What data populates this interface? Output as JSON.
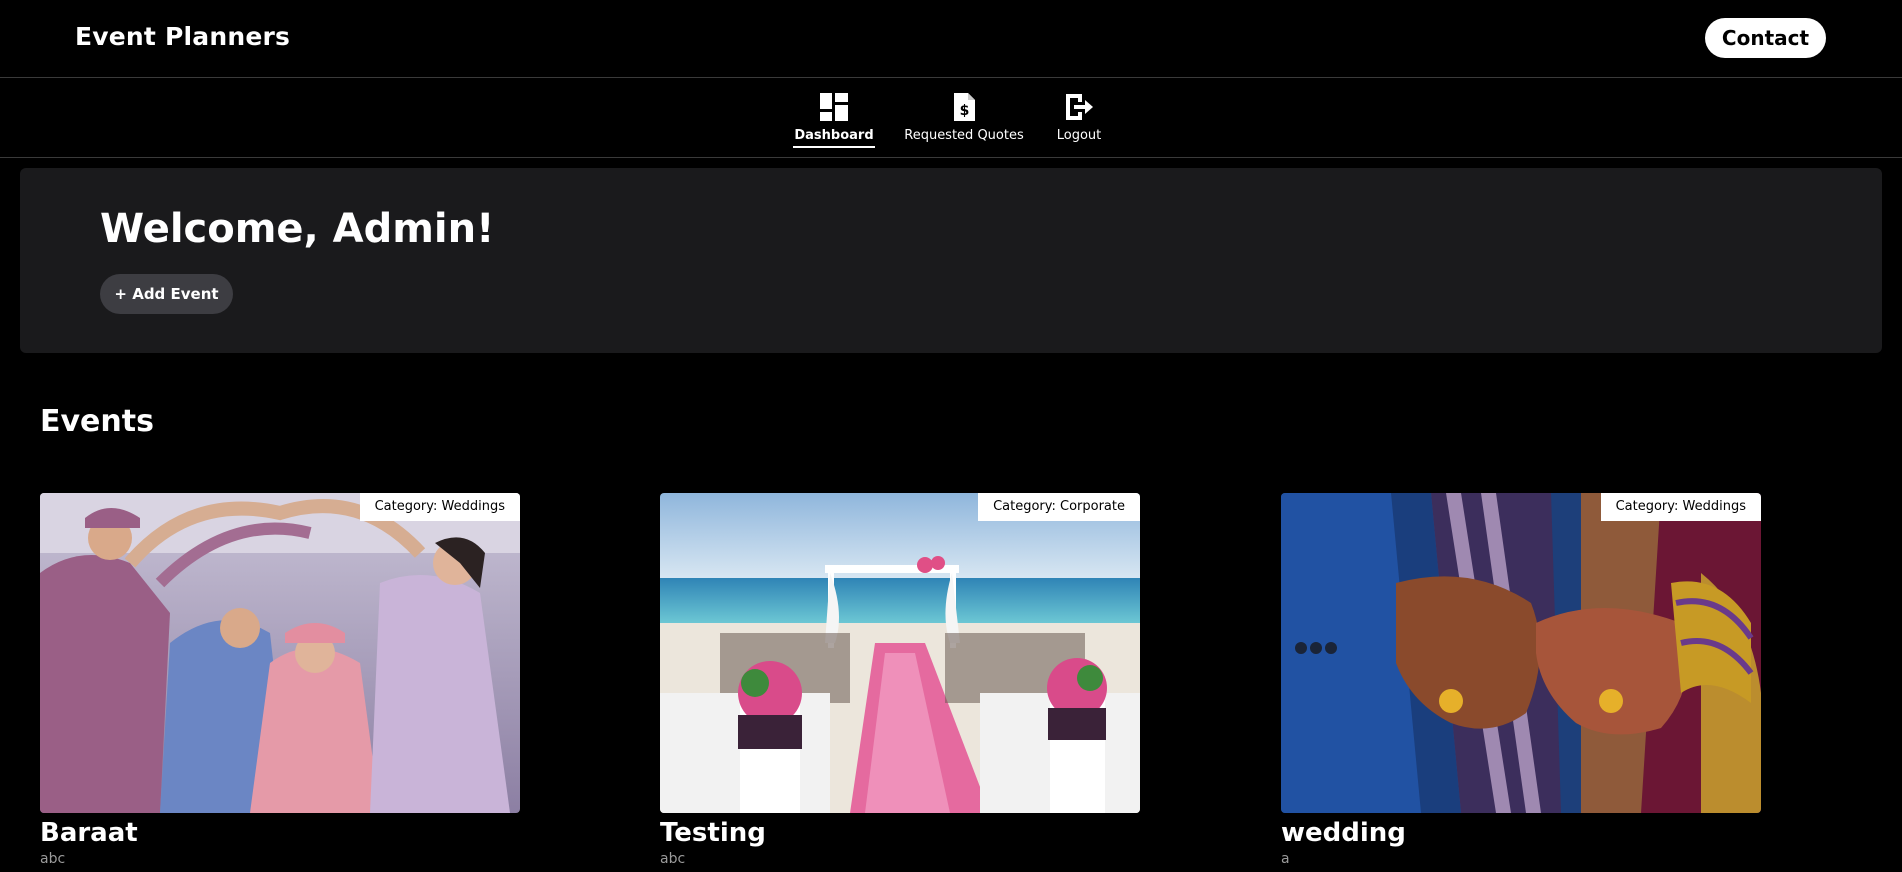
{
  "header": {
    "brand": "Event Planners",
    "contact_label": "Contact"
  },
  "nav": {
    "items": [
      {
        "label": "Dashboard",
        "icon": "dashboard-icon",
        "active": true
      },
      {
        "label": "Requested Quotes",
        "icon": "quote-document-icon",
        "active": false
      },
      {
        "label": "Logout",
        "icon": "logout-icon",
        "active": false
      }
    ]
  },
  "welcome": {
    "title": "Welcome, Admin!",
    "add_event_label": "+ Add Event"
  },
  "events": {
    "heading": "Events",
    "items": [
      {
        "title": "Baraat",
        "description": "abc",
        "category": "Category: Weddings",
        "image": "wedding-arch-photo"
      },
      {
        "title": "Testing",
        "description": "abc",
        "category": "Category: Corporate",
        "image": "beach-ceremony-photo"
      },
      {
        "title": "wedding",
        "description": "a",
        "category": "Category: Weddings",
        "image": "henna-hands-photo"
      }
    ]
  },
  "colors": {
    "background": "#000000",
    "panel": "#1a1a1c",
    "button_secondary": "#3d3d42",
    "text_muted": "#9a9a9a"
  }
}
